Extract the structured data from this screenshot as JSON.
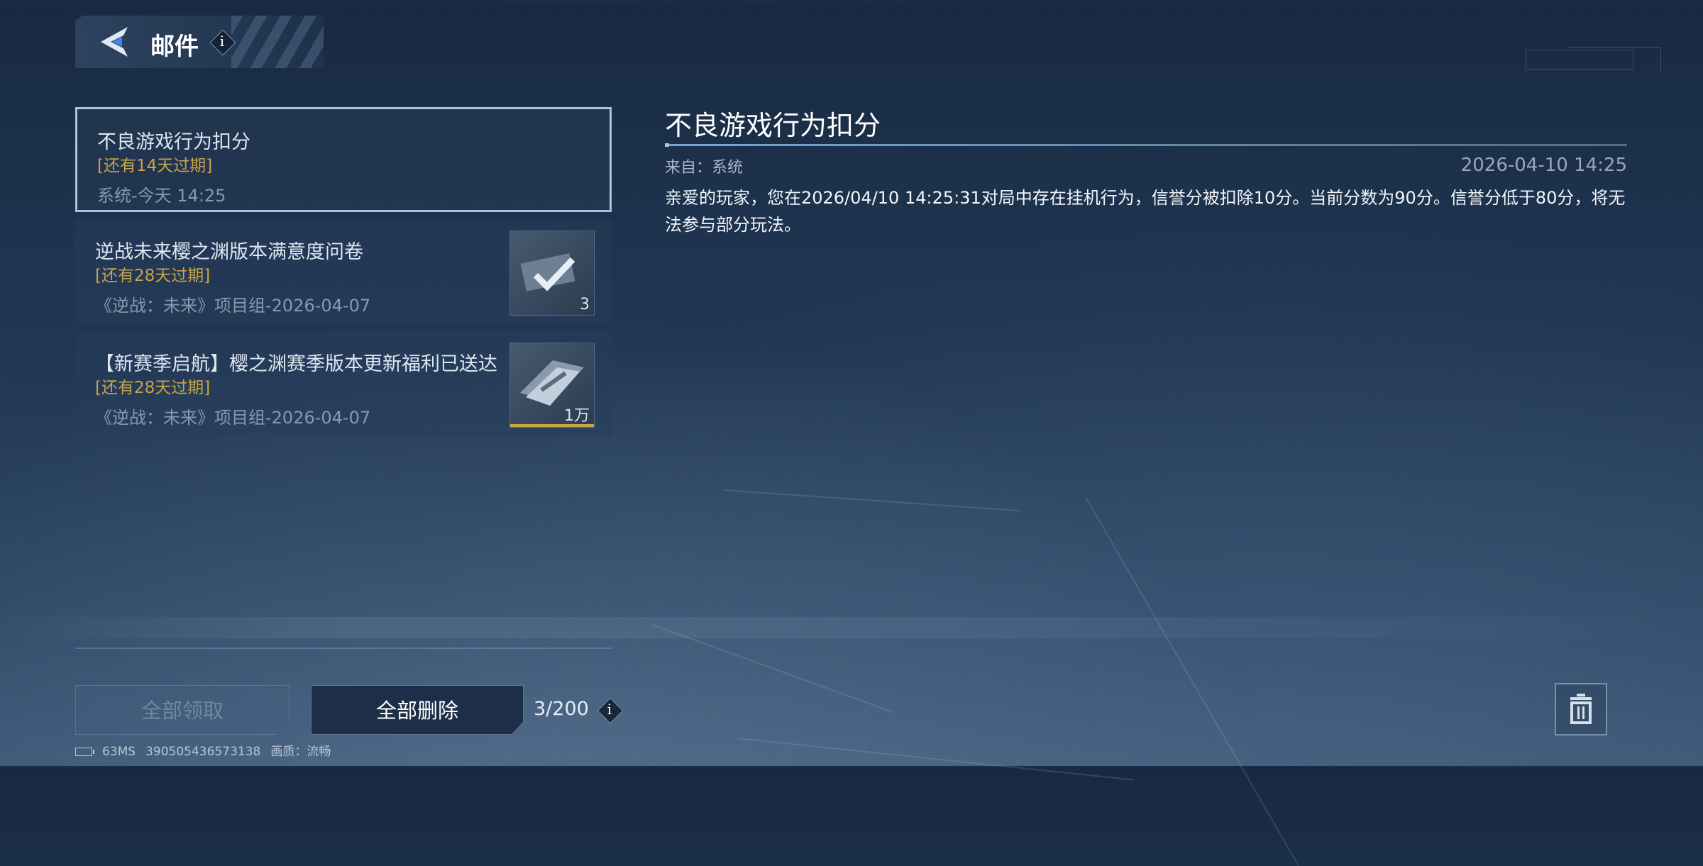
{
  "header": {
    "title": "邮件",
    "info_icon": "i"
  },
  "mails": [
    {
      "title": "不良游戏行为扣分",
      "expire": "[还有14天过期]",
      "meta": "系统-今天 14:25",
      "selected": true
    },
    {
      "title": "逆战未来樱之渊版本满意度问卷",
      "expire": "[还有28天过期]",
      "meta": "《逆战：未来》项目组-2026-04-07",
      "attachment_count": "3",
      "attachment_icon": "checkmark-ticket-icon"
    },
    {
      "title": "【新赛季启航】樱之渊赛季版本更新福利已送达",
      "expire": "[还有28天过期]",
      "meta": "《逆战：未来》项目组-2026-04-07",
      "attachment_count": "1万",
      "attachment_icon": "currency-ticket-icon"
    }
  ],
  "detail": {
    "title": "不良游戏行为扣分",
    "from": "来自：系统",
    "date": "2026-04-10 14:25",
    "body": "亲爱的玩家，您在2026/04/10 14:25:31对局中存在挂机行为，信誉分被扣除10分。当前分数为90分。信誉分低于80分，将无法参与部分玩法。"
  },
  "footer": {
    "claim_all": "全部领取",
    "delete_all": "全部删除",
    "mail_count": "3/200",
    "info_icon": "i"
  },
  "status": {
    "ping": "63MS",
    "id": "390505436573138",
    "quality": "画质：流畅"
  },
  "colors": {
    "expire": "#c9a347",
    "accent": "#7aa7d0",
    "selected_border": "#a9c5de"
  }
}
